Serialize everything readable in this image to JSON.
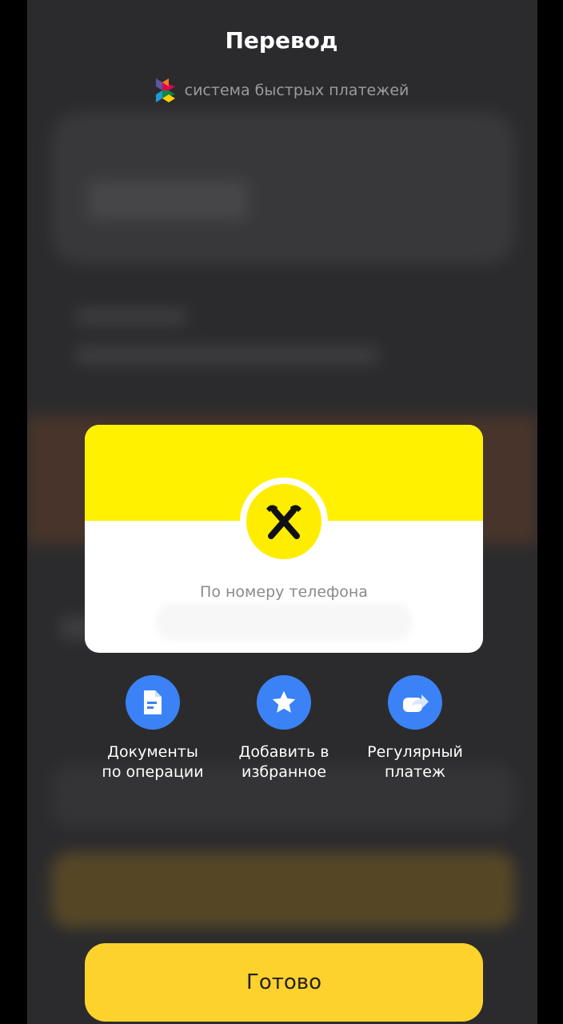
{
  "header": {
    "title": "Перевод",
    "sbp_label": "система быстрых платежей"
  },
  "modal": {
    "bank_logo_icon": "raiffeisen-logo-icon",
    "subtitle": "По номеру телефона",
    "colors": {
      "top": "#fff100",
      "bottom": "#ffffff"
    }
  },
  "actions": [
    {
      "label": "Документы\nпо операции",
      "icon": "document-icon"
    },
    {
      "label": "Добавить в\nизбранное",
      "icon": "star-icon"
    },
    {
      "label": "Регулярный\nплатеж",
      "icon": "share-arrow-icon"
    }
  ],
  "done_button": {
    "label": "Готово",
    "color": "#fed22c"
  },
  "colors": {
    "accent_blue": "#3b82f6",
    "background": "#2b2b2d"
  }
}
